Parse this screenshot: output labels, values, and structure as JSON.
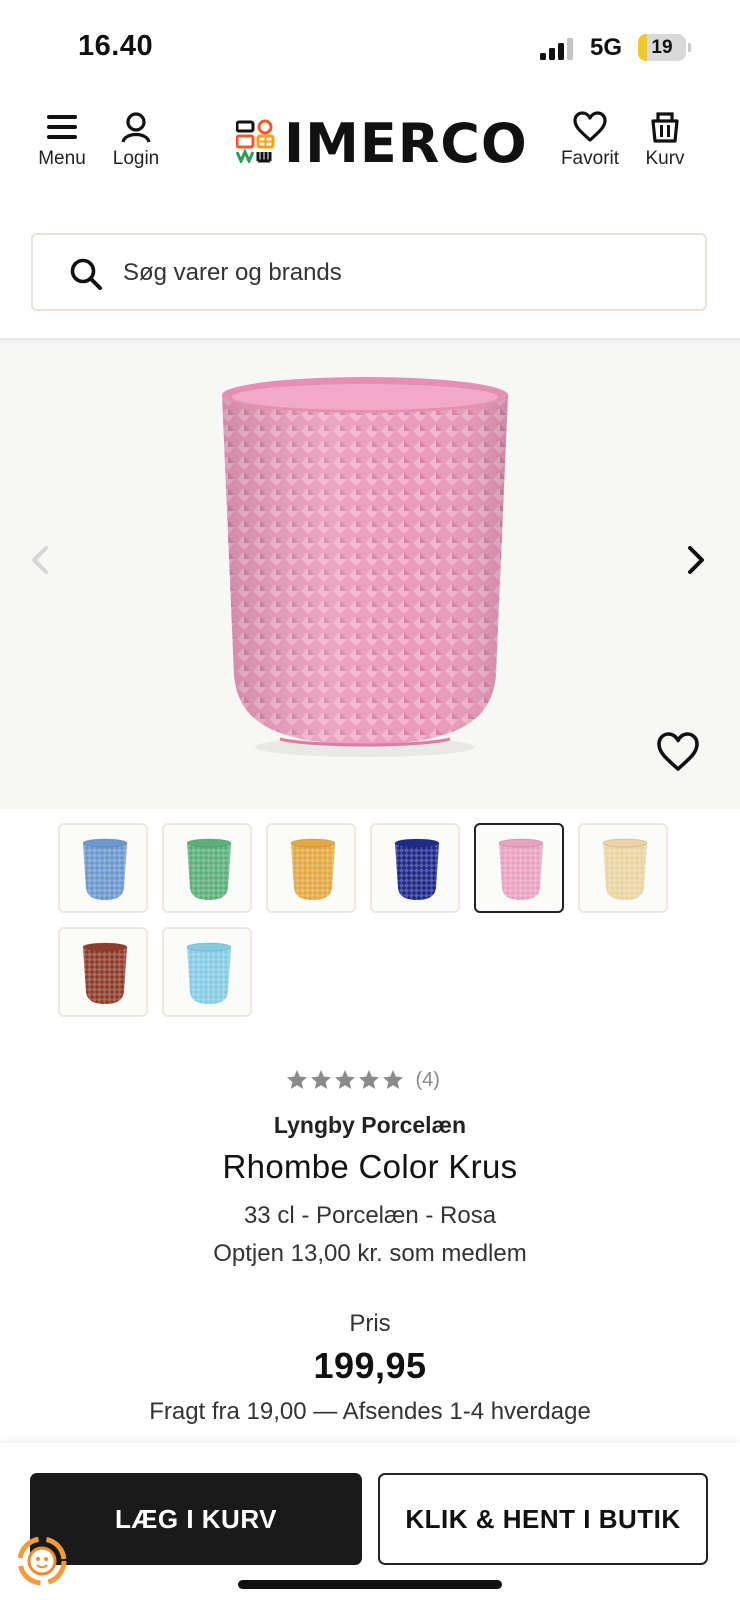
{
  "status_bar": {
    "time": "16.40",
    "network": "5G",
    "battery_level": "19",
    "battery_fraction": 0.19,
    "battery_color": "#f2c72c"
  },
  "header": {
    "menu_label": "Menu",
    "login_label": "Login",
    "logo_text": "IMERCO",
    "favorite_label": "Favorit",
    "cart_label": "Kurv"
  },
  "search": {
    "placeholder": "Søg varer og brands"
  },
  "gallery": {
    "main_image": "pink-mug",
    "main_color": "#e79ab8"
  },
  "thumbnails": [
    {
      "name": "blue",
      "color": "#6b98cf",
      "selected": false
    },
    {
      "name": "green",
      "color": "#5daf79",
      "selected": false
    },
    {
      "name": "yellow",
      "color": "#e4a843",
      "selected": false
    },
    {
      "name": "dark-blue",
      "color": "#1f2a8a",
      "selected": false
    },
    {
      "name": "pink",
      "color": "#eaa2bf",
      "selected": true
    },
    {
      "name": "sand",
      "color": "#ead4a2",
      "selected": false
    },
    {
      "name": "brown",
      "color": "#8e3d2b",
      "selected": false
    },
    {
      "name": "light-blue",
      "color": "#86cbe4",
      "selected": false
    }
  ],
  "product": {
    "rating_stars": 5,
    "rating_count": "(4)",
    "brand": "Lyngby Porcelæn",
    "name": "Rhombe Color Krus",
    "variant": "33 cl - Porcelæn - Rosa",
    "member_bonus": "Optjen 13,00 kr. som medlem",
    "price_label": "Pris",
    "price": "199,95",
    "shipping": "Fragt fra 19,00 — Afsendes 1-4 hverdage"
  },
  "actions": {
    "add_to_cart": "LÆG I KURV",
    "click_collect": "KLIK & HENT I BUTIK"
  }
}
